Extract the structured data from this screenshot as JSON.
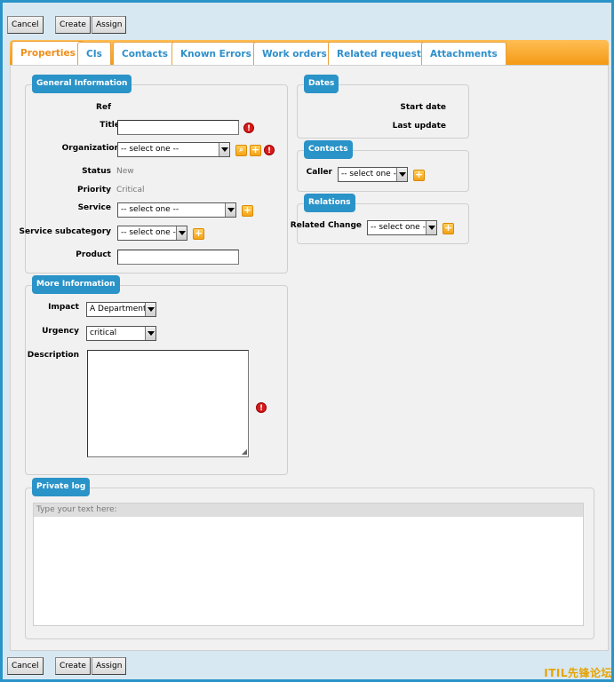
{
  "toolbar": {
    "cancel_label": "Cancel",
    "create_label": "Create",
    "assign_label": "Assign"
  },
  "tabs": [
    {
      "label": "Properties",
      "active": true
    },
    {
      "label": "CIs"
    },
    {
      "label": "Contacts"
    },
    {
      "label": "Known Errors"
    },
    {
      "label": "Work orders"
    },
    {
      "label": "Related requests"
    },
    {
      "label": "Attachments"
    }
  ],
  "general": {
    "legend": "General Information",
    "ref_label": "Ref",
    "title_label": "Title",
    "title_value": "",
    "organization_label": "Organization",
    "organization_value": "-- select one --",
    "status_label": "Status",
    "status_value": "New",
    "priority_label": "Priority",
    "priority_value": "Critical",
    "service_label": "Service",
    "service_value": "-- select one --",
    "subcategory_label": "Service subcategory",
    "subcategory_value": "-- select one --",
    "product_label": "Product",
    "product_value": ""
  },
  "more": {
    "legend": "More Information",
    "impact_label": "Impact",
    "impact_value": "A Department",
    "urgency_label": "Urgency",
    "urgency_value": "critical",
    "description_label": "Description"
  },
  "dates": {
    "legend": "Dates",
    "start_label": "Start date",
    "update_label": "Last update"
  },
  "contacts": {
    "legend": "Contacts",
    "caller_label": "Caller",
    "caller_value": "-- select one --"
  },
  "relations": {
    "legend": "Relations",
    "change_label": "Related Change",
    "change_value": "-- select one --"
  },
  "private_log": {
    "legend": "Private log",
    "placeholder": "Type your text here:"
  },
  "icons": {
    "plus": "+",
    "error": "!",
    "search": "⌕"
  },
  "colors": {
    "accent_blue": "#2a93c8",
    "tab_orange": "#f49a14",
    "error_red": "#d81a1a"
  },
  "watermark": "ITIL先锋论坛"
}
